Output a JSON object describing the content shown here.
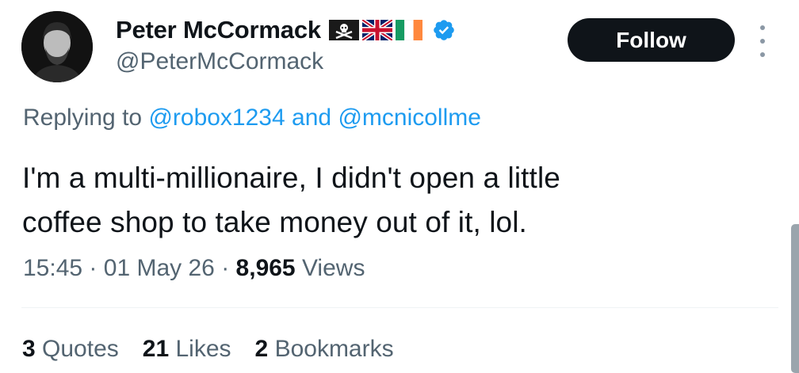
{
  "author": {
    "display_name": "Peter McCormack",
    "handle": "@PeterMcCormack",
    "flags": [
      "pirate-flag-icon",
      "uk-flag-icon",
      "ireland-flag-icon"
    ],
    "verified_color": "#1d9bf0"
  },
  "follow_button": {
    "label": "Follow"
  },
  "reply": {
    "prefix": "Replying to",
    "mention_1": "@robox1234",
    "conjunction": "and",
    "mention_2": "@mcnicollme"
  },
  "tweet": {
    "line_1": "I'm a multi-millionaire, I didn't open a little",
    "line_2": "coffee shop to take money out of it, lol."
  },
  "meta": {
    "time": "15:45",
    "separator": "·",
    "date": "01 May 26",
    "views_count": "8,965",
    "views_label": "Views"
  },
  "stats": {
    "quotes_count": "3",
    "quotes_label": "Quotes",
    "likes_count": "21",
    "likes_label": "Likes",
    "bookmarks_count": "2",
    "bookmarks_label": "Bookmarks"
  },
  "colors": {
    "accent": "#1d9bf0",
    "text": "#0f1419",
    "secondary_text": "#536471"
  }
}
